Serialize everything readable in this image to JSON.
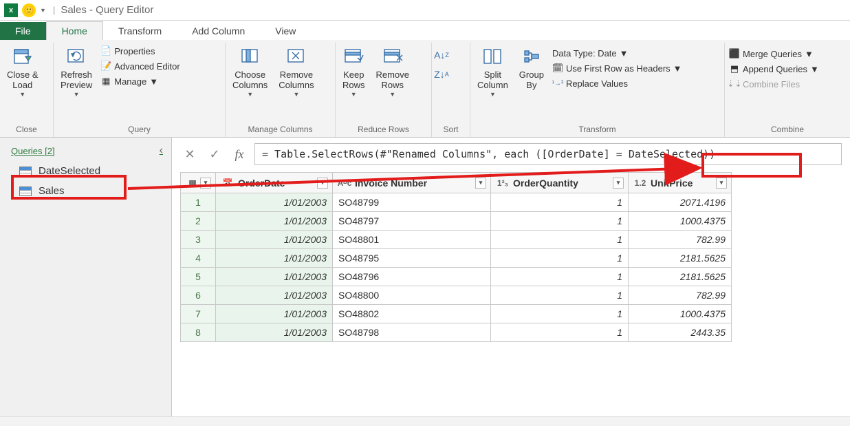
{
  "titlebar": {
    "title": "Sales - Query Editor"
  },
  "tabs": {
    "file": "File",
    "home": "Home",
    "transform": "Transform",
    "addcolumn": "Add Column",
    "view": "View"
  },
  "ribbon": {
    "close": {
      "label": "Close &\nLoad",
      "group": "Close"
    },
    "refresh": {
      "label": "Refresh\nPreview"
    },
    "properties": "Properties",
    "advanced": "Advanced Editor",
    "manage": "Manage",
    "query_group": "Query",
    "choose": "Choose\nColumns",
    "remove": "Remove\nColumns",
    "manage_cols_group": "Manage Columns",
    "keep": "Keep\nRows",
    "remove_rows": "Remove\nRows",
    "reduce_group": "Reduce Rows",
    "sort_group": "Sort",
    "split": "Split\nColumn",
    "groupby": "Group\nBy",
    "datatype": "Data Type: Date",
    "firstrow": "Use First Row as Headers",
    "replace": "Replace Values",
    "transform_group": "Transform",
    "merge": "Merge Queries",
    "append": "Append Queries",
    "combinefiles": "Combine Files",
    "combine_group": "Combine"
  },
  "queries": {
    "header": "Queries [2]",
    "items": [
      "DateSelected",
      "Sales"
    ]
  },
  "formula": {
    "text": "= Table.SelectRows(#\"Renamed Columns\", each ([OrderDate] = DateSelected))"
  },
  "columns": {
    "c1": "OrderDate",
    "c2": "Invoice Number",
    "c3": "OrderQuantity",
    "c4": "UnitPrice"
  },
  "rows": [
    {
      "n": "1",
      "date": "1/01/2003",
      "inv": "SO48799",
      "qty": "1",
      "price": "2071.4196"
    },
    {
      "n": "2",
      "date": "1/01/2003",
      "inv": "SO48797",
      "qty": "1",
      "price": "1000.4375"
    },
    {
      "n": "3",
      "date": "1/01/2003",
      "inv": "SO48801",
      "qty": "1",
      "price": "782.99"
    },
    {
      "n": "4",
      "date": "1/01/2003",
      "inv": "SO48795",
      "qty": "1",
      "price": "2181.5625"
    },
    {
      "n": "5",
      "date": "1/01/2003",
      "inv": "SO48796",
      "qty": "1",
      "price": "2181.5625"
    },
    {
      "n": "6",
      "date": "1/01/2003",
      "inv": "SO48800",
      "qty": "1",
      "price": "782.99"
    },
    {
      "n": "7",
      "date": "1/01/2003",
      "inv": "SO48802",
      "qty": "1",
      "price": "1000.4375"
    },
    {
      "n": "8",
      "date": "1/01/2003",
      "inv": "SO48798",
      "qty": "1",
      "price": "2443.35"
    }
  ]
}
